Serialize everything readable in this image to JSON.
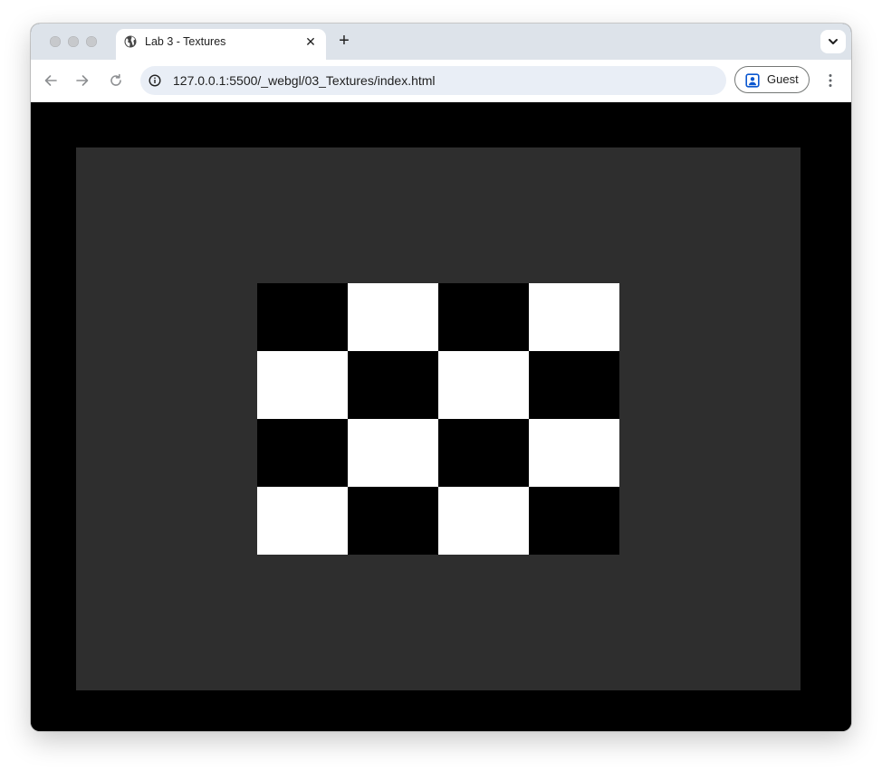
{
  "browser": {
    "tab": {
      "title": "Lab 3 - Textures",
      "favicon": "globe-icon"
    },
    "toolbar": {
      "url": "127.0.0.1:5500/_webgl/03_Textures/index.html",
      "profile_label": "Guest"
    }
  },
  "page": {
    "clear_color": "#000000",
    "canvas_color": "#2e2e2e",
    "checkerboard": {
      "rows": 4,
      "cols": 4,
      "colors": [
        "#000000",
        "#ffffff"
      ],
      "first_cell": "#000000"
    }
  }
}
